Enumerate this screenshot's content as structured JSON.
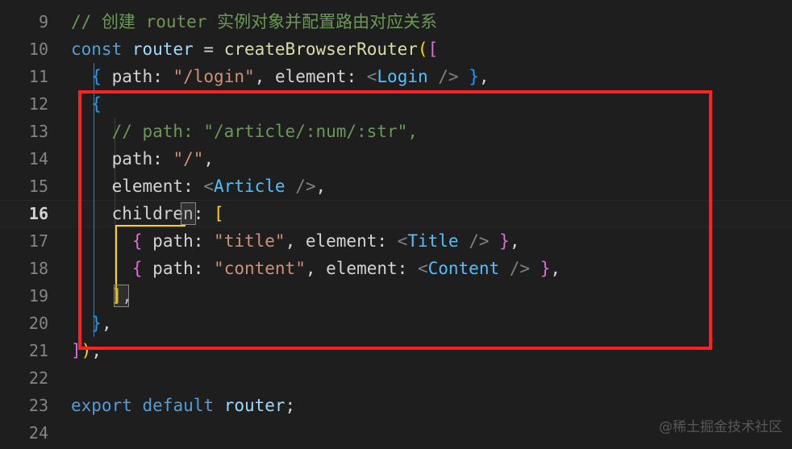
{
  "editor": {
    "background": "#1e1e1e",
    "font_size_px": 21,
    "line_height_px": 34,
    "active_line": 16,
    "first_visible_line": 9,
    "last_visible_line": 24
  },
  "gutter": {
    "line_numbers": [
      "9",
      "10",
      "11",
      "12",
      "13",
      "14",
      "15",
      "16",
      "17",
      "18",
      "19",
      "20",
      "21",
      "22",
      "23",
      "24"
    ]
  },
  "colors": {
    "comment": "#6a9955",
    "keyword": "#569cd6",
    "variable": "#9cdcfe",
    "function": "#dcdcaa",
    "string": "#ce9178",
    "plain": "#d4d4d4",
    "component": "#4fc1ff",
    "punct": "#808080",
    "bracket_yellow": "#ffd700",
    "bracket_pink": "#da70d6",
    "bracket_blue": "#179fff",
    "annotation_red": "#fa2222",
    "line_number": "#858585",
    "active_line_number": "#d4d4d4"
  },
  "code": {
    "lines": [
      {
        "number": "9",
        "indent": 0,
        "text": "// 创建 router 实例对象并配置路由对应关系"
      },
      {
        "number": "10",
        "indent": 0,
        "text": "const router = createBrowserRouter(["
      },
      {
        "number": "11",
        "indent": 2,
        "text": "{ path: \"/login\", element: <Login /> },"
      },
      {
        "number": "12",
        "indent": 2,
        "text": "{"
      },
      {
        "number": "13",
        "indent": 4,
        "text": "// path: \"/article/:num/:str\","
      },
      {
        "number": "14",
        "indent": 4,
        "text": "path: \"/\","
      },
      {
        "number": "15",
        "indent": 4,
        "text": "element: <Article />,"
      },
      {
        "number": "16",
        "indent": 4,
        "text": "children: ["
      },
      {
        "number": "17",
        "indent": 6,
        "text": "{ path: \"title\", element: <Title /> },"
      },
      {
        "number": "18",
        "indent": 6,
        "text": "{ path: \"content\", element: <Content /> },"
      },
      {
        "number": "19",
        "indent": 4,
        "text": "],"
      },
      {
        "number": "20",
        "indent": 2,
        "text": "},"
      },
      {
        "number": "21",
        "indent": 0,
        "text": "]);"
      },
      {
        "number": "22",
        "indent": 0,
        "text": ""
      },
      {
        "number": "23",
        "indent": 0,
        "text": "export default router;"
      },
      {
        "number": "24",
        "indent": 0,
        "text": ""
      }
    ],
    "tokens": {
      "l9": [
        [
          "// ",
          "comment"
        ],
        [
          "创建 router 实例对象并配置路由对应关系",
          "comment"
        ]
      ],
      "l10": [
        [
          "const",
          "keyword"
        ],
        [
          " ",
          "plain"
        ],
        [
          "router",
          "var"
        ],
        [
          " ",
          "plain"
        ],
        [
          "=",
          "plain"
        ],
        [
          " ",
          "plain"
        ],
        [
          "createBrowserRouter",
          "func"
        ],
        [
          "(",
          "br-yellow"
        ],
        [
          "[",
          "br-pink"
        ]
      ],
      "l11": [
        [
          "  ",
          "plain"
        ],
        [
          "{",
          "br-blue"
        ],
        [
          " ",
          "plain"
        ],
        [
          "path",
          "prop"
        ],
        [
          ": ",
          "plain"
        ],
        [
          "\"/login\"",
          "string"
        ],
        [
          ", ",
          "plain"
        ],
        [
          "element",
          "prop"
        ],
        [
          ": ",
          "plain"
        ],
        [
          "<",
          "punct"
        ],
        [
          "Login",
          "component"
        ],
        [
          " ",
          "plain"
        ],
        [
          "/>",
          "punct"
        ],
        [
          " ",
          "plain"
        ],
        [
          "}",
          "br-blue"
        ],
        [
          ",",
          "plain"
        ]
      ],
      "l12": [
        [
          "  ",
          "plain"
        ],
        [
          "{",
          "br-blue"
        ]
      ],
      "l13": [
        [
          "    ",
          "plain"
        ],
        [
          "// path: \"/article/:num/:str\",",
          "comment"
        ]
      ],
      "l14": [
        [
          "    ",
          "plain"
        ],
        [
          "path",
          "prop"
        ],
        [
          ": ",
          "plain"
        ],
        [
          "\"/\"",
          "string"
        ],
        [
          ",",
          "plain"
        ]
      ],
      "l15": [
        [
          "    ",
          "plain"
        ],
        [
          "element",
          "prop"
        ],
        [
          ": ",
          "plain"
        ],
        [
          "<",
          "punct"
        ],
        [
          "Article",
          "component"
        ],
        [
          " ",
          "plain"
        ],
        [
          "/>",
          "punct"
        ],
        [
          ",",
          "plain"
        ]
      ],
      "l16": [
        [
          "    ",
          "plain"
        ],
        [
          "children",
          "prop"
        ],
        [
          ": ",
          "plain"
        ],
        [
          "[",
          "br-yellow"
        ]
      ],
      "l17": [
        [
          "      ",
          "plain"
        ],
        [
          "{",
          "br-pink"
        ],
        [
          " ",
          "plain"
        ],
        [
          "path",
          "prop"
        ],
        [
          ": ",
          "plain"
        ],
        [
          "\"title\"",
          "string"
        ],
        [
          ", ",
          "plain"
        ],
        [
          "element",
          "prop"
        ],
        [
          ": ",
          "plain"
        ],
        [
          "<",
          "punct"
        ],
        [
          "Title",
          "component"
        ],
        [
          " ",
          "plain"
        ],
        [
          "/>",
          "punct"
        ],
        [
          " ",
          "plain"
        ],
        [
          "}",
          "br-pink"
        ],
        [
          ",",
          "plain"
        ]
      ],
      "l18": [
        [
          "      ",
          "plain"
        ],
        [
          "{",
          "br-pink"
        ],
        [
          " ",
          "plain"
        ],
        [
          "path",
          "prop"
        ],
        [
          ": ",
          "plain"
        ],
        [
          "\"content\"",
          "string"
        ],
        [
          ", ",
          "plain"
        ],
        [
          "element",
          "prop"
        ],
        [
          ": ",
          "plain"
        ],
        [
          "<",
          "punct"
        ],
        [
          "Content",
          "component"
        ],
        [
          " ",
          "plain"
        ],
        [
          "/>",
          "punct"
        ],
        [
          " ",
          "plain"
        ],
        [
          "}",
          "br-pink"
        ],
        [
          ",",
          "plain"
        ]
      ],
      "l19": [
        [
          "    ",
          "plain"
        ],
        [
          "]",
          "br-yellow"
        ],
        [
          ",",
          "plain"
        ]
      ],
      "l20": [
        [
          "  ",
          "plain"
        ],
        [
          "}",
          "br-blue"
        ],
        [
          ",",
          "plain"
        ]
      ],
      "l21": [
        [
          "]",
          "br-pink"
        ],
        [
          ")",
          "br-yellow"
        ],
        [
          ";",
          "plain"
        ]
      ],
      "l22": [],
      "l23": [
        [
          "export",
          "keyword"
        ],
        [
          " ",
          "plain"
        ],
        [
          "default",
          "keyword"
        ],
        [
          " ",
          "plain"
        ],
        [
          "router",
          "var"
        ],
        [
          ";",
          "plain"
        ]
      ],
      "l24": []
    }
  },
  "annotation": {
    "type": "red-rectangle",
    "covers_lines": "12-21",
    "color": "#fa2222"
  },
  "bracket_pair_guide": {
    "open_line": "16",
    "close_line": "19",
    "bracket": "[",
    "color": "#ffd700"
  },
  "watermark": {
    "text": "@稀土掘金技术社区"
  }
}
